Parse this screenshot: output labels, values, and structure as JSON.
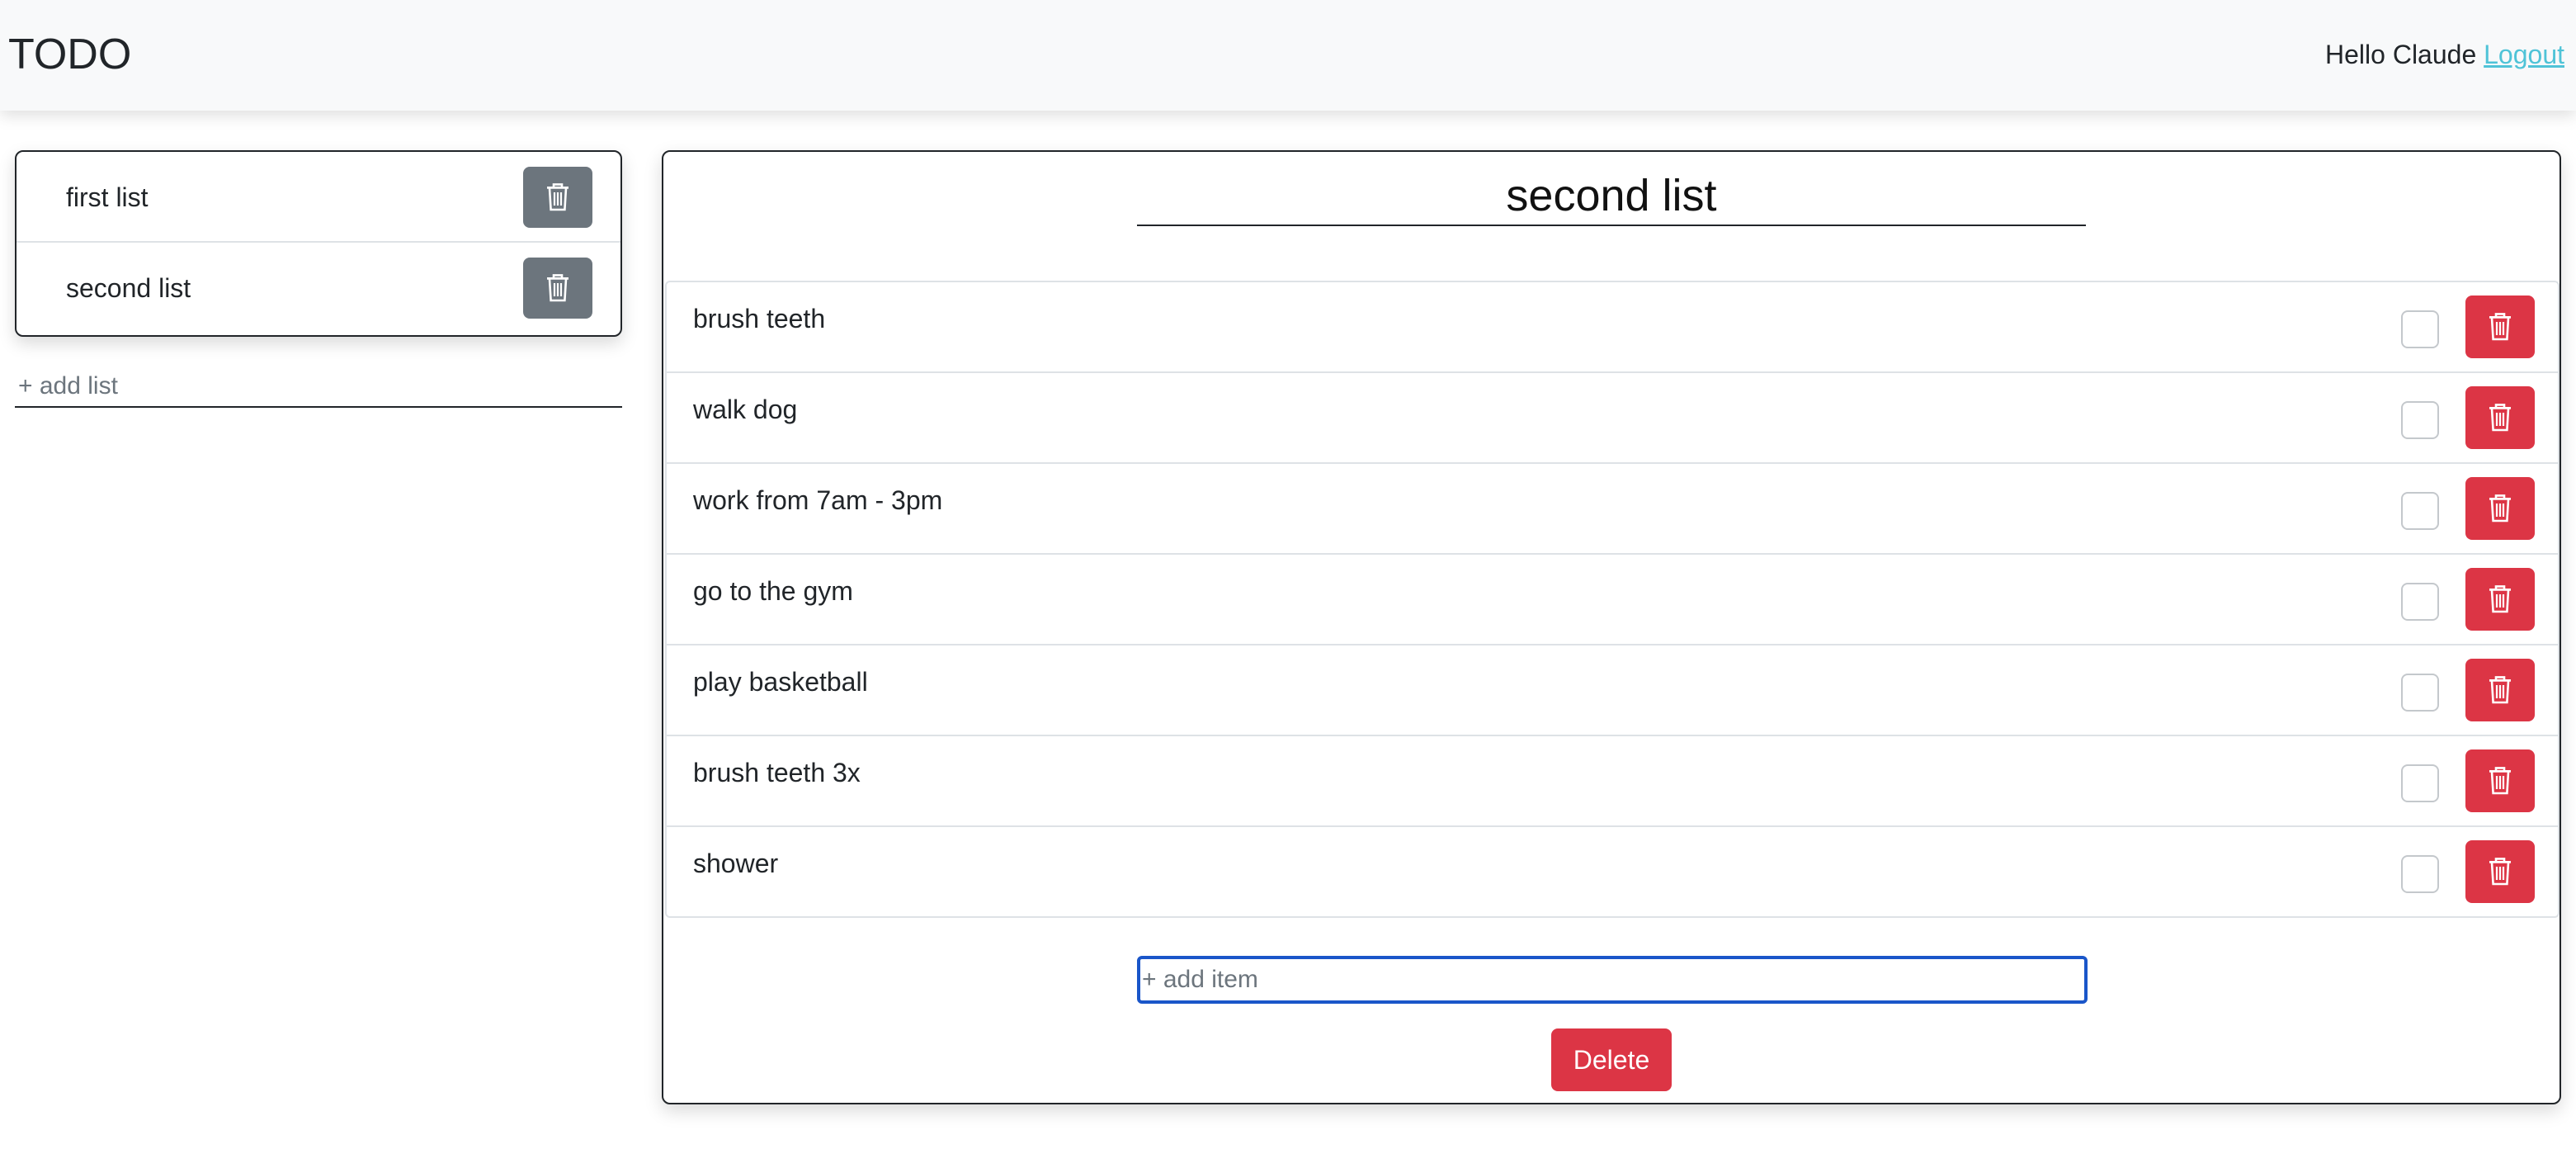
{
  "navbar": {
    "brand": "TODO",
    "greeting": "Hello Claude",
    "logout_label": "Logout",
    "background": "#f8f9fa",
    "link_color": "#4fc3d7"
  },
  "sidebar": {
    "lists": [
      {
        "label": "first list",
        "delete_icon": "trash-icon"
      },
      {
        "label": "second list",
        "delete_icon": "trash-icon"
      }
    ],
    "add_list_placeholder": "+ add list",
    "button_color": "#6c757d"
  },
  "main": {
    "title": "second list",
    "items": [
      {
        "text": "brush teeth",
        "checked": false
      },
      {
        "text": "walk dog",
        "checked": false
      },
      {
        "text": "work from 7am - 3pm",
        "checked": false
      },
      {
        "text": "go to the gym",
        "checked": false
      },
      {
        "text": "play basketball",
        "checked": false
      },
      {
        "text": "brush teeth 3x",
        "checked": false
      },
      {
        "text": "shower",
        "checked": false
      }
    ],
    "add_item_placeholder": "+ add item",
    "delete_label": "Delete",
    "danger_color": "#dc3545",
    "focus_color": "#1a56c9"
  }
}
